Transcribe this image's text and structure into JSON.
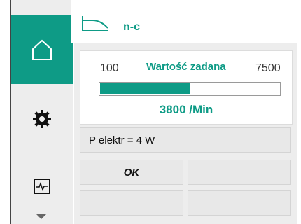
{
  "header": {
    "title": "n-c",
    "icon": "control-curve-icon"
  },
  "sidebar": {
    "items": [
      {
        "name": "home",
        "icon": "home-icon",
        "active": true
      },
      {
        "name": "settings",
        "icon": "gear-icon",
        "active": false
      },
      {
        "name": "diagnostics",
        "icon": "pulse-monitor-icon",
        "active": false
      }
    ],
    "scroll_icon": "scroll-down-arrow-icon"
  },
  "setpoint": {
    "min": "100",
    "max": "7500",
    "label": "Wartość zadana",
    "value_text": "3800 /Min",
    "min_value": 100,
    "max_value": 7500,
    "current_value": 3800
  },
  "info": {
    "power_text": "P elektr = 4 W"
  },
  "softkeys": {
    "ok_label": "OK"
  },
  "colors": {
    "accent": "#0e9b86",
    "panel_bg": "#ededed"
  }
}
